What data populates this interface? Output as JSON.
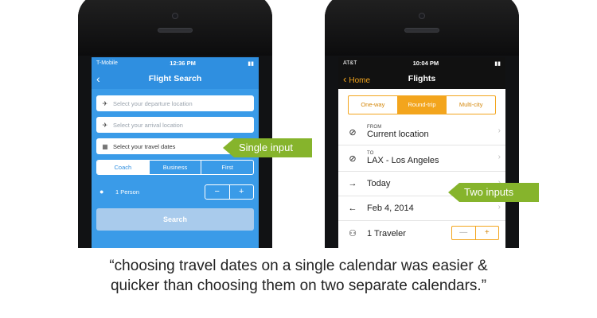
{
  "left_phone": {
    "status": {
      "carrier": "T-Mobile",
      "time": "12:36 PM"
    },
    "nav": {
      "back": "‹",
      "title": "Flight Search"
    },
    "fields": [
      {
        "icon": "plane-takeoff-icon",
        "glyph": "✈",
        "placeholder": "Select your departure location"
      },
      {
        "icon": "plane-landing-icon",
        "glyph": "✈",
        "placeholder": "Select your arrival location"
      },
      {
        "icon": "calendar-icon",
        "glyph": "▦",
        "placeholder": "Select your travel dates"
      }
    ],
    "classes": [
      "Coach",
      "Business",
      "First"
    ],
    "selected_class": "Coach",
    "person": {
      "label": "1 Person",
      "minus": "−",
      "plus": "+"
    },
    "search_label": "Search"
  },
  "right_phone": {
    "status": {
      "carrier": "AT&T",
      "time": "10:04 PM"
    },
    "nav": {
      "back": "Home",
      "title": "Flights"
    },
    "trip_types": [
      "One-way",
      "Round-trip",
      "Multi-city"
    ],
    "selected_trip_type": "Round-trip",
    "from": {
      "label": "FROM",
      "value": "Current location"
    },
    "to": {
      "label": "TO",
      "value": "LAX - Los Angeles"
    },
    "depart": "Today",
    "return": "Feb 4, 2014",
    "travelers": {
      "label": "1 Traveler",
      "minus": "—",
      "plus": "+"
    }
  },
  "callouts": {
    "single": "Single input",
    "two": "Two inputs"
  },
  "quote": {
    "line1": "“choosing travel dates on a single calendar was easier &",
    "line2": "quicker than choosing them on two separate calendars.”"
  },
  "colors": {
    "left_accent": "#3a9be8",
    "right_accent": "#f3a51d",
    "callout_green": "#86b42c"
  }
}
